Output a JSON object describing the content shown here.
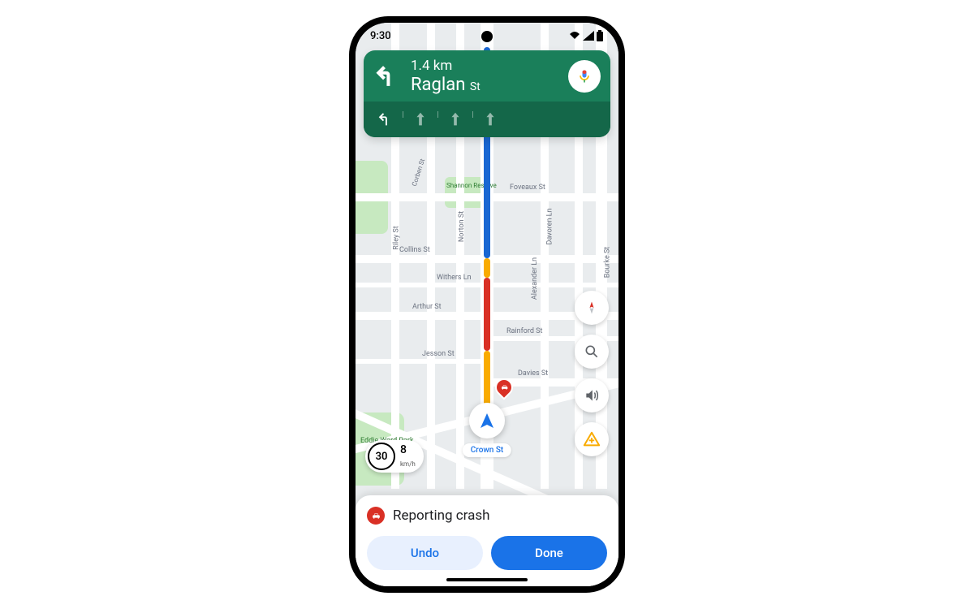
{
  "status_bar": {
    "time": "9:30"
  },
  "navigation": {
    "distance": "1.4 km",
    "street_name": "Raglan",
    "street_suffix": "St",
    "direction_icon": "turn-left",
    "lanes": [
      {
        "icon": "turn-left",
        "active": true
      },
      {
        "icon": "straight",
        "active": false
      },
      {
        "icon": "straight",
        "active": false
      },
      {
        "icon": "straight",
        "active": false
      }
    ]
  },
  "floating_buttons": {
    "compass": "compass-icon",
    "search": "search-icon",
    "audio": "volume-icon",
    "report": "report-hazard-icon"
  },
  "speed": {
    "limit": "30",
    "current": "8",
    "unit": "km/h"
  },
  "location": {
    "current_street": "Crown St"
  },
  "report_sheet": {
    "icon": "crash-icon",
    "title": "Reporting crash",
    "undo_label": "Undo",
    "done_label": "Done"
  },
  "map_streets": {
    "foveaux": "Foveaux St",
    "collins": "Collins St",
    "withers": "Withers Ln",
    "arthur": "Arthur St",
    "rainford": "Rainford St",
    "jesson": "Jesson St",
    "davies": "Davies St",
    "riley": "Riley St",
    "norton": "Norton St",
    "alexander": "Alexander Ln",
    "davoren": "Davoren Ln",
    "bourke": "Bourke St",
    "corben": "Corben St",
    "shannon": "Shannon Reserve",
    "eddie": "Eddie Ward Park"
  },
  "colors": {
    "nav_green": "#1a7f5a",
    "nav_green_dark": "#146749",
    "primary_blue": "#1a73e8",
    "route_blue": "#1967d2",
    "traffic_orange": "#f9ab00",
    "traffic_red": "#d93025"
  }
}
